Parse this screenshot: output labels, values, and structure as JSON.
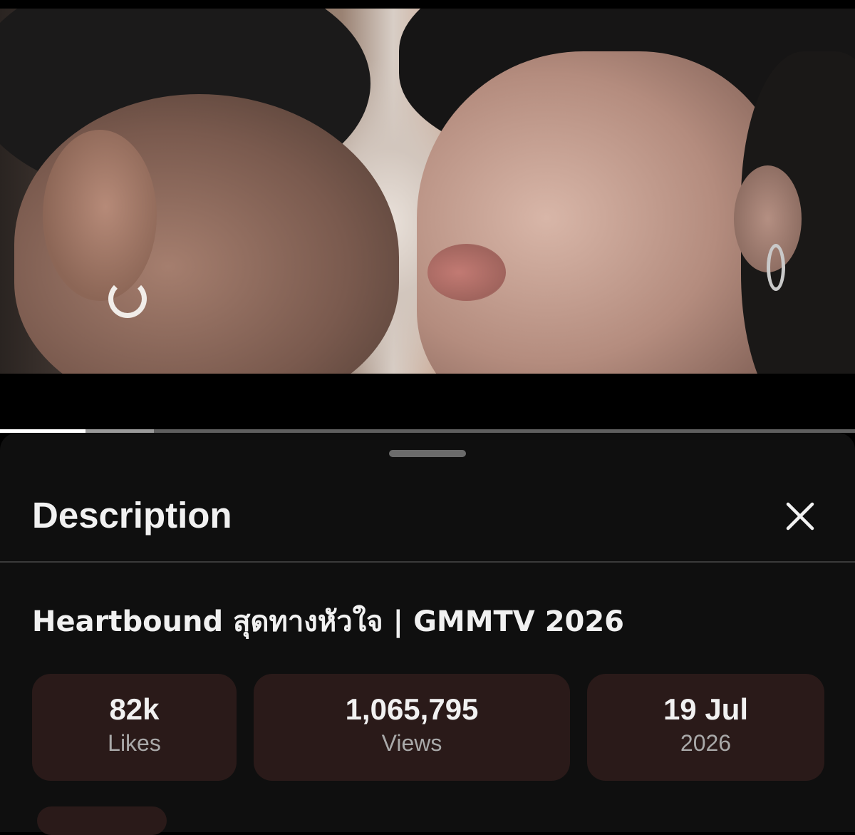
{
  "video": {
    "thumbnail_icon": "video-frame-image",
    "progress": {
      "played_percent": 10,
      "buffered_percent": 18
    }
  },
  "sheet": {
    "title": "Description",
    "close_icon": "close-icon",
    "video_title": "Heartbound สุดทางหัวใจ | GMMTV 2026",
    "stats": {
      "likes": {
        "value": "82k",
        "label": "Likes"
      },
      "views": {
        "value": "1,065,795",
        "label": "Views"
      },
      "date": {
        "value": "19 Jul",
        "label": "2026"
      }
    }
  },
  "colors": {
    "sheet_background": "#0f0f0f",
    "stat_card_background": "#2a1a19",
    "primary_text": "#f1f1f1",
    "secondary_text": "#a9a9a9"
  }
}
